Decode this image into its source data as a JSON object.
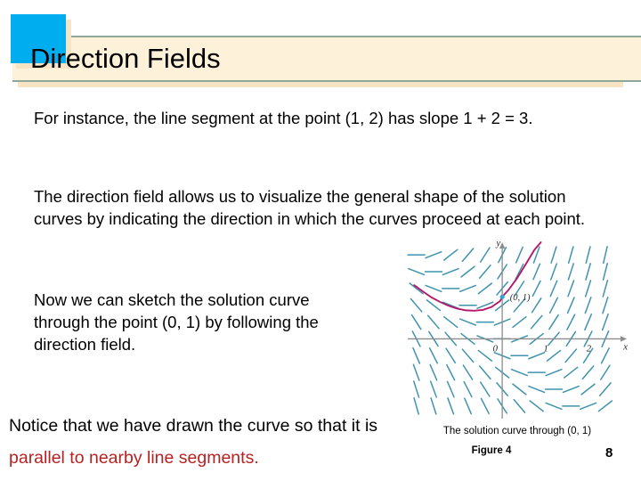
{
  "header": {
    "title": "Direction Fields",
    "band_color": "#fdf1d9",
    "band_border_color": "#8fa79a",
    "swatch_color": "#00aeef"
  },
  "body": {
    "paragraph_1": "For instance, the line segment at the point (1, 2) has slope 1 + 2 = 3.",
    "paragraph_2": "The direction field allows us to visualize the general shape of the solution curves by indicating the direction in which the curves proceed at each point.",
    "paragraph_3": "Now we can sketch the solution curve through the point (0, 1) by following the direction field.",
    "paragraph_4_plain_a": "Notice that we have drawn the curve so that it is",
    "paragraph_4_highlight": "parallel to nearby line segments.",
    "highlight_color": "#b82121"
  },
  "figure": {
    "caption": "The solution curve through (0, 1)",
    "figure_number": "Figure 4",
    "page_number": "8",
    "point_label": "(0, 1)",
    "segment_color": "#3f93ae",
    "curve_color": "#b51a6b",
    "axis_color": "#8c8c8c",
    "point_color": "#2fa9c9"
  },
  "chart_data": {
    "type": "scatter",
    "title": "The solution curve through (0, 1)",
    "xlabel": "x",
    "ylabel": "y",
    "xlim": [
      -2.2,
      2.9
    ],
    "ylim": [
      -1.9,
      2.3
    ],
    "xticks": [
      0,
      1,
      2
    ],
    "xticklabels": [
      "0",
      "1",
      "2"
    ],
    "yticks": [],
    "yticklabels": [],
    "grid": false,
    "legend": null,
    "description": "Direction field (slope field) for the differential equation y' = x + y, with the solution curve passing through the point (0, 1) drawn in magenta.",
    "slope_formula": "x + y",
    "annotations": [
      {
        "text": "(0, 1)",
        "x": 0.18,
        "y": 0.92
      },
      {
        "text": "y",
        "x": -0.14,
        "y": 2.22
      },
      {
        "text": "x",
        "x": 2.82,
        "y": -0.26
      },
      {
        "text": "0",
        "x": -0.22,
        "y": -0.3
      },
      {
        "text": "1",
        "x": 0.96,
        "y": -0.3
      },
      {
        "text": "2",
        "x": 1.96,
        "y": -0.3
      }
    ],
    "marked_points": [
      {
        "x": 0,
        "y": 1,
        "label": "(0, 1)"
      }
    ],
    "curve": {
      "name": "solution curve through (0, 1)",
      "x": [
        -2.05,
        -1.85,
        -1.65,
        -1.45,
        -1.25,
        -1.05,
        -0.85,
        -0.65,
        -0.45,
        -0.25,
        -0.05,
        0.0,
        0.15,
        0.35,
        0.55,
        0.75,
        0.9
      ],
      "y": [
        1.28,
        1.13,
        0.99,
        0.88,
        0.79,
        0.72,
        0.68,
        0.67,
        0.69,
        0.76,
        0.9,
        1.0,
        1.17,
        1.45,
        1.78,
        2.12,
        2.3
      ]
    },
    "field_grid": {
      "x": [
        -2.0,
        -1.6,
        -1.2,
        -0.8,
        -0.4,
        0.0,
        0.4,
        0.8,
        1.2,
        1.6,
        2.0,
        2.4
      ],
      "y": [
        -1.6,
        -1.2,
        -0.8,
        -0.4,
        0.0,
        0.4,
        0.8,
        1.2,
        1.6,
        2.0
      ]
    }
  }
}
